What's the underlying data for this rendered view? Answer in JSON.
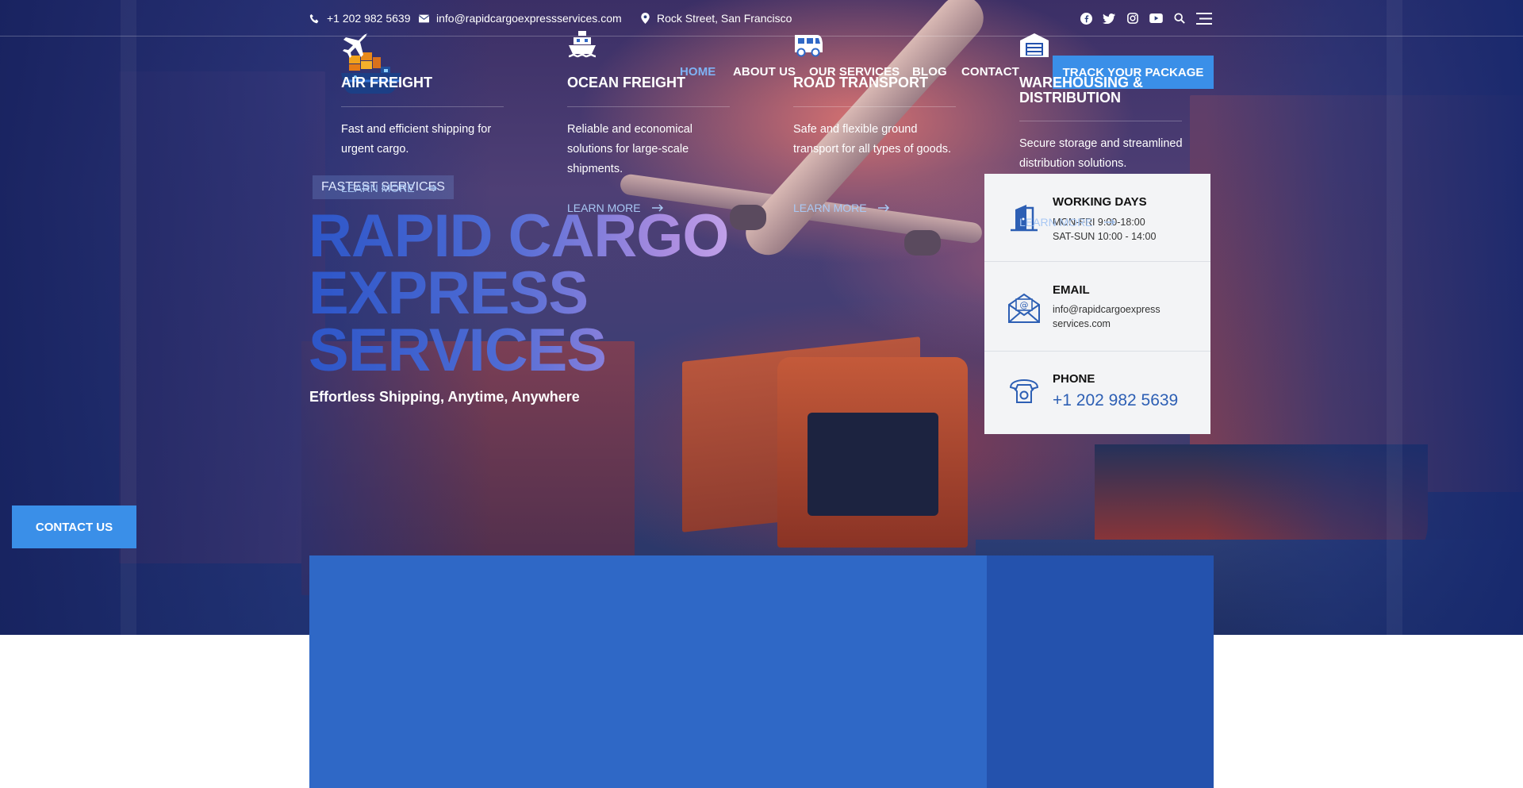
{
  "topbar": {
    "phone": "+1 202 982 5639",
    "email": "info@rapidcargoexpressservices.com",
    "address": "Rock Street, San Francisco",
    "social_icons": [
      "facebook-icon",
      "twitter-icon",
      "instagram-icon",
      "youtube-icon",
      "search-icon",
      "menu-icon"
    ]
  },
  "nav": {
    "items": [
      {
        "label": "HOME",
        "active": true
      },
      {
        "label": "ABOUT US",
        "active": false
      },
      {
        "label": "OUR SERVICES",
        "active": false
      },
      {
        "label": "BLOG",
        "active": false
      },
      {
        "label": "CONTACT",
        "active": false
      }
    ],
    "cta": "TRACK YOUR PACKAGE"
  },
  "hero": {
    "eyebrow": "FASTEST SERVICES",
    "title_line1": "RAPID CARGO",
    "title_line2": "EXPRESS",
    "title_line3": "SERVICES",
    "subtitle": "Effortless Shipping, Anytime, Anywhere",
    "contact_button": "CONTACT US"
  },
  "info": {
    "working": {
      "title": "WORKING DAYS",
      "line1": "MON-FRI 9:00-18:00",
      "line2": "SAT-SUN 10:00 - 14:00"
    },
    "email": {
      "title": "EMAIL",
      "line1": "info@rapidcargoexpress",
      "line2": "services.com"
    },
    "phone": {
      "title": "PHONE",
      "value": "+1 202 982 5639"
    }
  },
  "services": [
    {
      "title": "AIR FREIGHT",
      "desc": "Fast and efficient shipping for urgent cargo.",
      "link": "LEARN MORE",
      "icon": "plane-icon"
    },
    {
      "title": "OCEAN FREIGHT",
      "desc": "Reliable and economical solutions for large-scale shipments.",
      "link": "LEARN MORE",
      "icon": "ship-icon"
    },
    {
      "title": "ROAD TRANSPORT",
      "desc": "Safe and flexible ground transport for all types of goods.",
      "link": "LEARN MORE",
      "icon": "truck-icon"
    },
    {
      "title": "WAREHOUSING & DISTRIBUTION",
      "desc": "Secure storage and streamlined distribution solutions.",
      "link": "LEARN MORE",
      "icon": "warehouse-icon"
    }
  ],
  "colors": {
    "accent": "#3a8fe8",
    "band": "#2f68c6",
    "band_dark": "#2452ad",
    "active_nav": "#7fb2f4"
  }
}
